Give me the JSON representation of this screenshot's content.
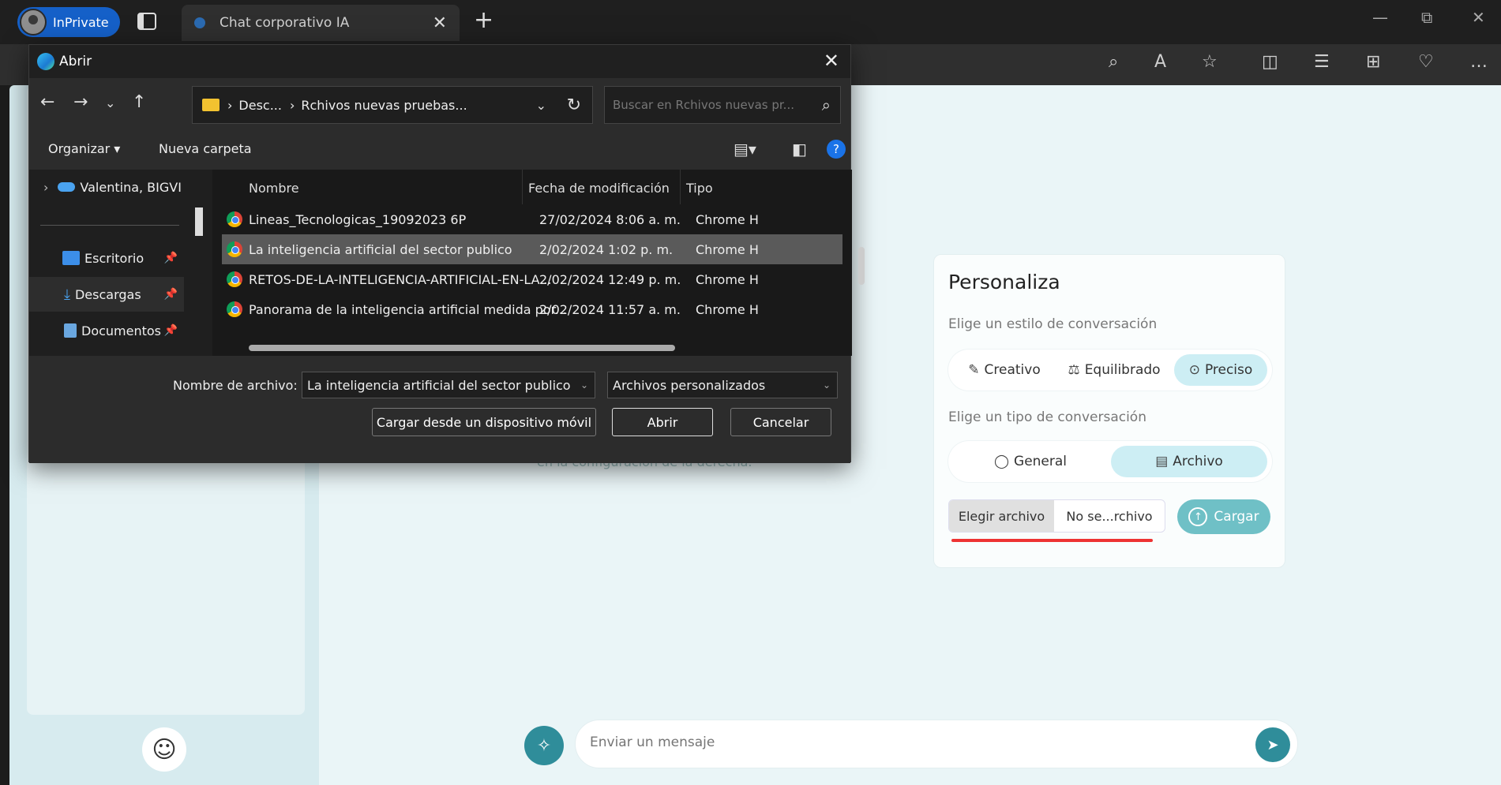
{
  "browser": {
    "profile_label": "InPrivate",
    "tab_title": "Chat corporativo IA",
    "close_tab": "✕",
    "new_tab": "+"
  },
  "page": {
    "hidden_text": "en la configuración de la derecha.",
    "personaliza": {
      "title": "Personaliza",
      "style_label": "Elige un estilo de conversación",
      "styles": [
        {
          "label": "Creativo",
          "icon": "pencil-icon"
        },
        {
          "label": "Equilibrado",
          "icon": "scale-icon"
        },
        {
          "label": "Preciso",
          "icon": "target-icon"
        }
      ],
      "selected_style": "Preciso",
      "type_label": "Elige un tipo de conversación",
      "types": [
        {
          "label": "General",
          "icon": "chat-bubble-icon"
        },
        {
          "label": "Archivo",
          "icon": "document-icon"
        }
      ],
      "selected_type": "Archivo",
      "choose_file": "Elegir archivo",
      "no_file": "No se...rchivo",
      "upload": "Cargar"
    },
    "message_placeholder": "Enviar un mensaje"
  },
  "dialog": {
    "title": "Abrir",
    "path": {
      "segments": [
        "Desc...",
        "Rchivos nuevas pruebas..."
      ]
    },
    "search_placeholder": "Buscar en Rchivos nuevas pr...",
    "organize": "Organizar ▾",
    "new_folder": "Nueva carpeta",
    "nav_items": [
      {
        "label": "Valentina, BIGVI"
      },
      {
        "label": "Escritorio"
      },
      {
        "label": "Descargas"
      },
      {
        "label": "Documentos"
      }
    ],
    "columns": {
      "name": "Nombre",
      "date": "Fecha de modificación",
      "type": "Tipo"
    },
    "files": [
      {
        "name": "Lineas_Tecnologicas_19092023 6P",
        "date": "27/02/2024 8:06 a. m.",
        "type": "Chrome H"
      },
      {
        "name": "La inteligencia artificial del sector publico",
        "date": "2/02/2024 1:02 p. m.",
        "type": "Chrome H"
      },
      {
        "name": "RETOS-DE-LA-INTELIGENCIA-ARTIFICIAL-EN-LA...",
        "date": "2/02/2024 12:49 p. m.",
        "type": "Chrome H"
      },
      {
        "name": "Panorama de la inteligencia artificial medida por...",
        "date": "2/02/2024 11:57 a. m.",
        "type": "Chrome H"
      }
    ],
    "filename_label": "Nombre de archivo:",
    "filename_value": "La inteligencia artificial del sector publico",
    "filetype_value": "Archivos personalizados",
    "mobile_button": "Cargar desde un dispositivo móvil",
    "open_button": "Abrir",
    "cancel_button": "Cancelar"
  },
  "colors": {
    "accent": "#2f8d9a",
    "selected_option": "#cdeef4",
    "underline": "#ee3333"
  }
}
